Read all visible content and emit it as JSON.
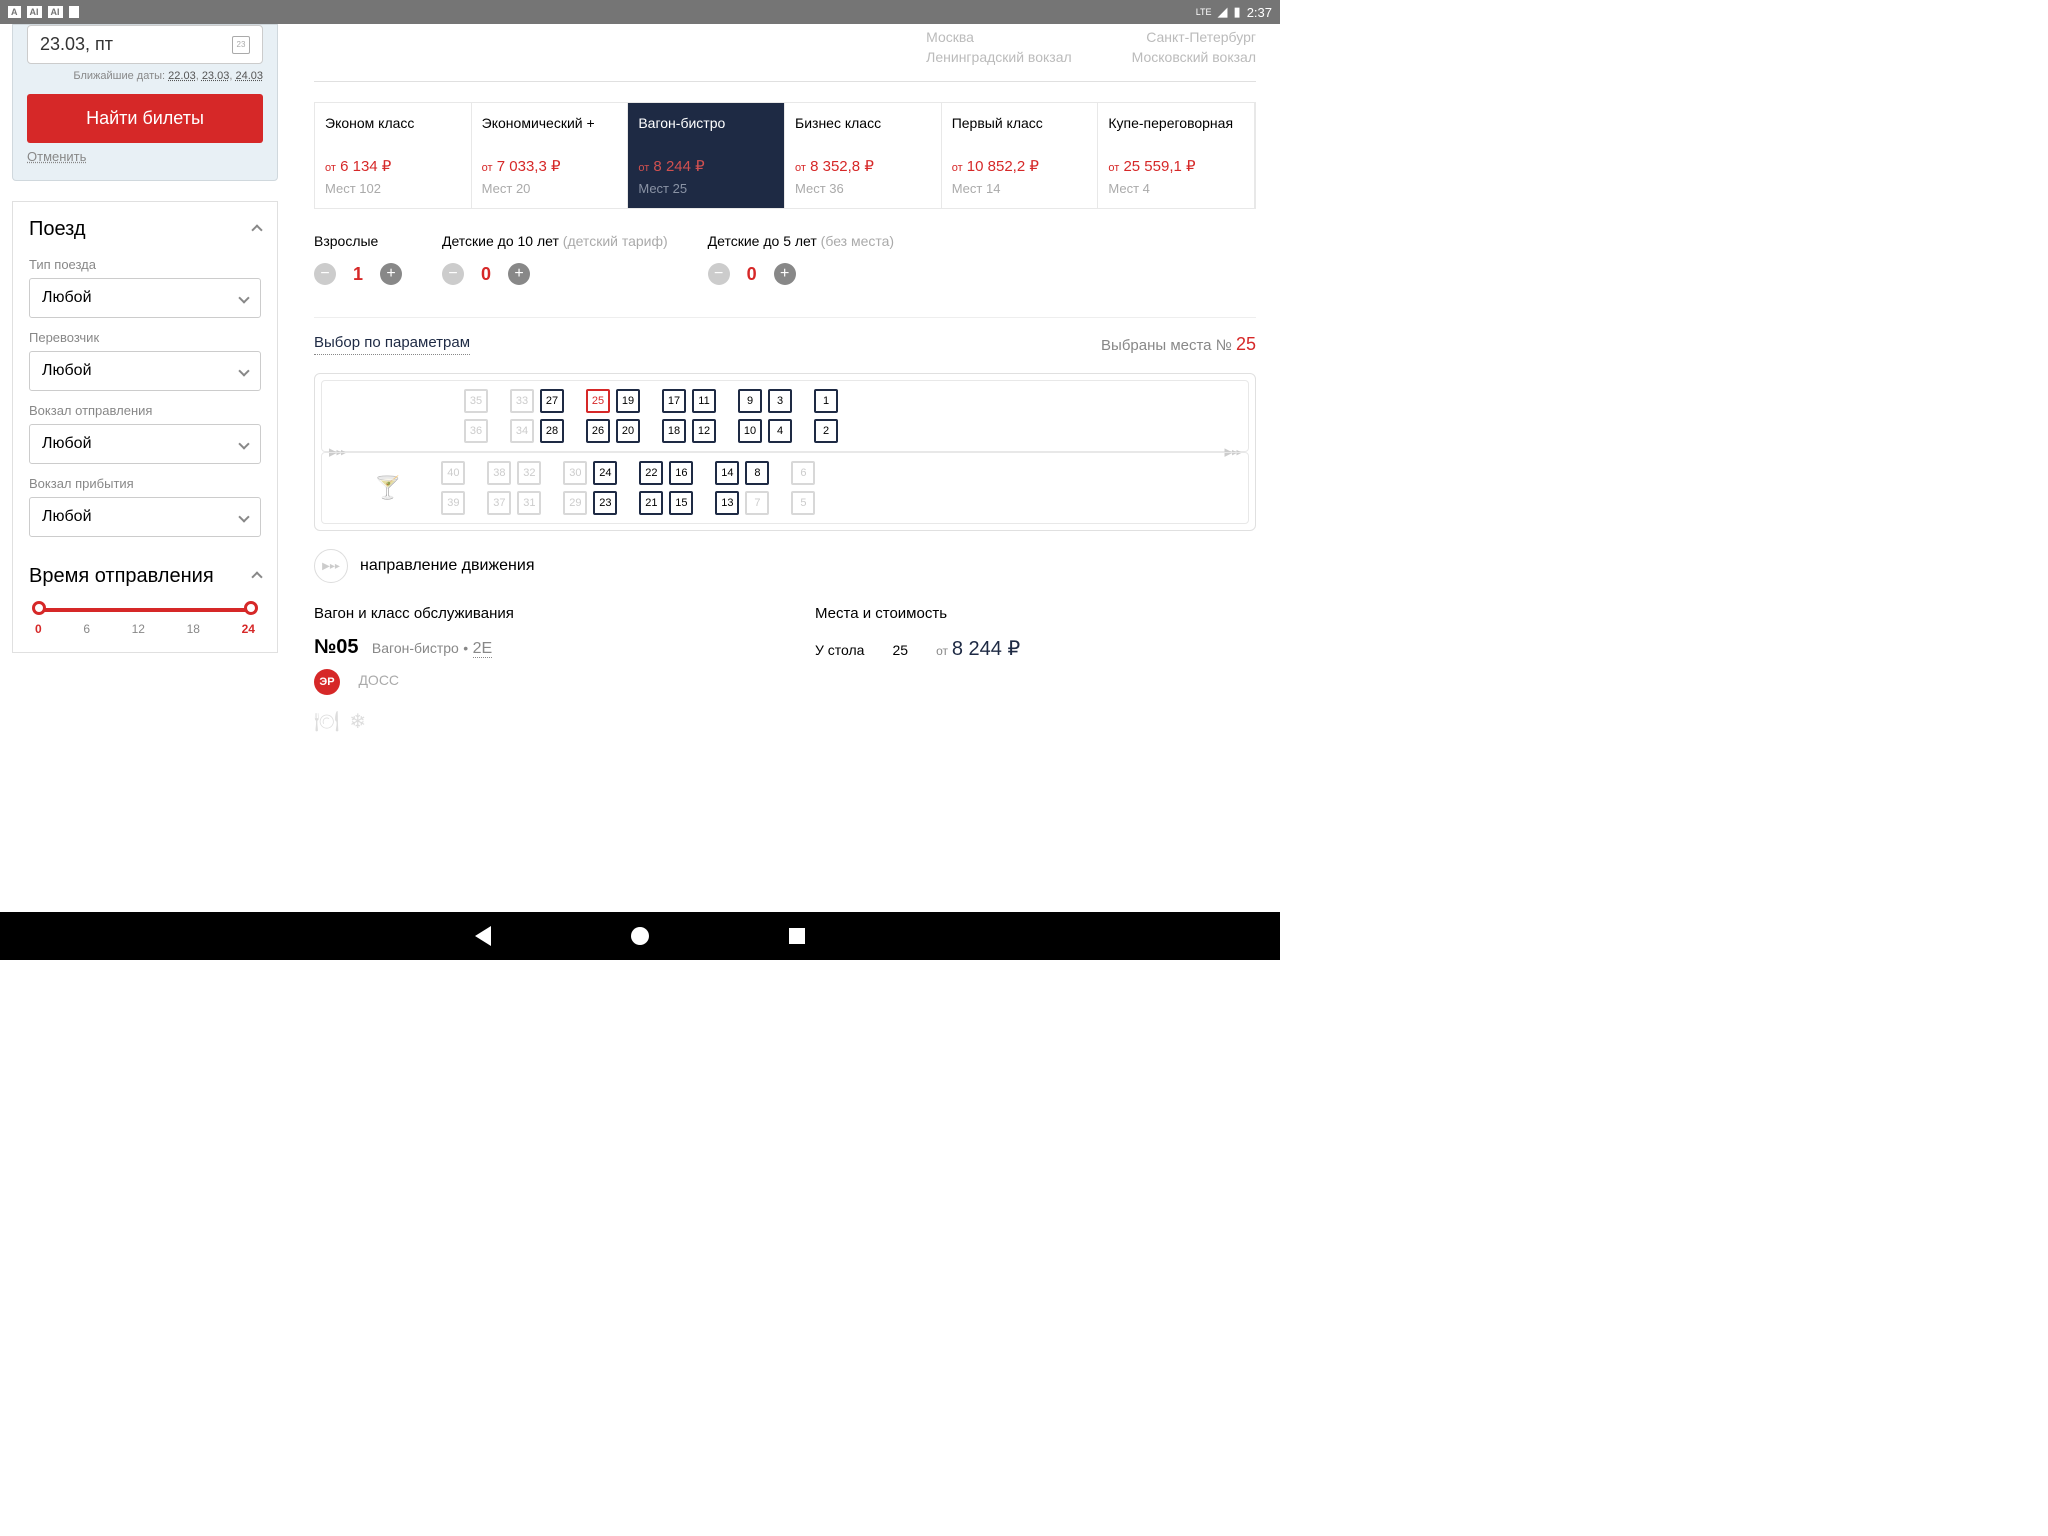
{
  "status_bar": {
    "time": "2:37",
    "lte": "LTE",
    "icons": [
      "A",
      "AI",
      "AI"
    ]
  },
  "search": {
    "date_display": "23.03, пт",
    "nearby_label": "Ближайшие даты:",
    "nearby_dates": [
      "22.03",
      "23.03",
      "24.03"
    ],
    "button": "Найти билеты",
    "cancel": "Отменить"
  },
  "filters": {
    "train_title": "Поезд",
    "type_label": "Тип поезда",
    "carrier_label": "Перевозчик",
    "dep_station_label": "Вокзал отправления",
    "arr_station_label": "Вокзал прибытия",
    "any": "Любой",
    "dep_time_title": "Время отправления",
    "slider": {
      "min": "0",
      "v6": "6",
      "v12": "12",
      "v18": "18",
      "max": "24"
    }
  },
  "route": {
    "from_city": "Москва",
    "from_station": "Ленинградский вокзал",
    "to_city": "Санкт-Петербург",
    "to_station": "Московский вокзал"
  },
  "classes": [
    {
      "name": "Эконом класс",
      "price": "6 134 ₽",
      "seats": "Мест 102"
    },
    {
      "name": "Экономический +",
      "price": "7 033,3 ₽",
      "seats": "Мест 20"
    },
    {
      "name": "Вагон-бистро",
      "price": "8 244 ₽",
      "seats": "Мест 25",
      "active": true
    },
    {
      "name": "Бизнес класс",
      "price": "8 352,8 ₽",
      "seats": "Мест 36"
    },
    {
      "name": "Первый класс",
      "price": "10 852,2 ₽",
      "seats": "Мест 14"
    },
    {
      "name": "Купе-переговорная",
      "price": "25 559,1 ₽",
      "seats": "Мест 4"
    }
  ],
  "ot": "от",
  "passengers": {
    "adults": {
      "label": "Взрослые",
      "count": "1"
    },
    "children": {
      "label": "Детские до 10 лет",
      "hint": "(детский тариф)",
      "count": "0"
    },
    "infants": {
      "label": "Детские до 5 лет",
      "hint": "(без места)",
      "count": "0"
    }
  },
  "params": {
    "link": "Выбор по параметрам",
    "selected_label": "Выбраны места №",
    "selected_num": "25"
  },
  "seat_map": {
    "top": {
      "row1": [
        {
          "n": "35",
          "d": true
        },
        {
          "n": "",
          "b": true
        },
        {
          "n": "33",
          "d": true
        },
        {
          "n": "27"
        },
        {
          "n": "",
          "b": true
        },
        {
          "n": "25",
          "s": true
        },
        {
          "n": "19"
        },
        {
          "n": "",
          "b": true
        },
        {
          "n": "17"
        },
        {
          "n": "11"
        },
        {
          "n": "",
          "b": true
        },
        {
          "n": "9"
        },
        {
          "n": "3"
        },
        {
          "n": "",
          "b": true
        },
        {
          "n": "1"
        }
      ],
      "row2": [
        {
          "n": "36",
          "d": true
        },
        {
          "n": "",
          "b": true
        },
        {
          "n": "34",
          "d": true
        },
        {
          "n": "28"
        },
        {
          "n": "",
          "b": true
        },
        {
          "n": "26"
        },
        {
          "n": "20"
        },
        {
          "n": "",
          "b": true
        },
        {
          "n": "18"
        },
        {
          "n": "12"
        },
        {
          "n": "",
          "b": true
        },
        {
          "n": "10"
        },
        {
          "n": "4"
        },
        {
          "n": "",
          "b": true
        },
        {
          "n": "2"
        }
      ]
    },
    "bottom": {
      "row1": [
        {
          "n": "40",
          "d": true
        },
        {
          "n": "",
          "b": true
        },
        {
          "n": "38",
          "d": true
        },
        {
          "n": "32",
          "d": true
        },
        {
          "n": "",
          "b": true
        },
        {
          "n": "30",
          "d": true
        },
        {
          "n": "24"
        },
        {
          "n": "",
          "b": true
        },
        {
          "n": "22"
        },
        {
          "n": "16"
        },
        {
          "n": "",
          "b": true
        },
        {
          "n": "14"
        },
        {
          "n": "8"
        },
        {
          "n": "",
          "b": true
        },
        {
          "n": "6",
          "d": true
        }
      ],
      "row2": [
        {
          "n": "39",
          "d": true
        },
        {
          "n": "",
          "b": true
        },
        {
          "n": "37",
          "d": true
        },
        {
          "n": "31",
          "d": true
        },
        {
          "n": "",
          "b": true
        },
        {
          "n": "29",
          "d": true
        },
        {
          "n": "23"
        },
        {
          "n": "",
          "b": true
        },
        {
          "n": "21"
        },
        {
          "n": "15"
        },
        {
          "n": "",
          "b": true
        },
        {
          "n": "13"
        },
        {
          "n": "7",
          "d": true
        },
        {
          "n": "",
          "b": true
        },
        {
          "n": "5",
          "d": true
        }
      ]
    }
  },
  "direction_label": "направление движения",
  "car_info": {
    "title": "Вагон и класс обслуживания",
    "number": "№05",
    "class_name": "Вагон-бистро",
    "dot": "•",
    "code": "2Е",
    "badge": "ЭР",
    "doss": "ДОСС"
  },
  "seats_info": {
    "title": "Места и стоимость",
    "position": "У стола",
    "seat": "25",
    "price": "8 244 ₽"
  }
}
